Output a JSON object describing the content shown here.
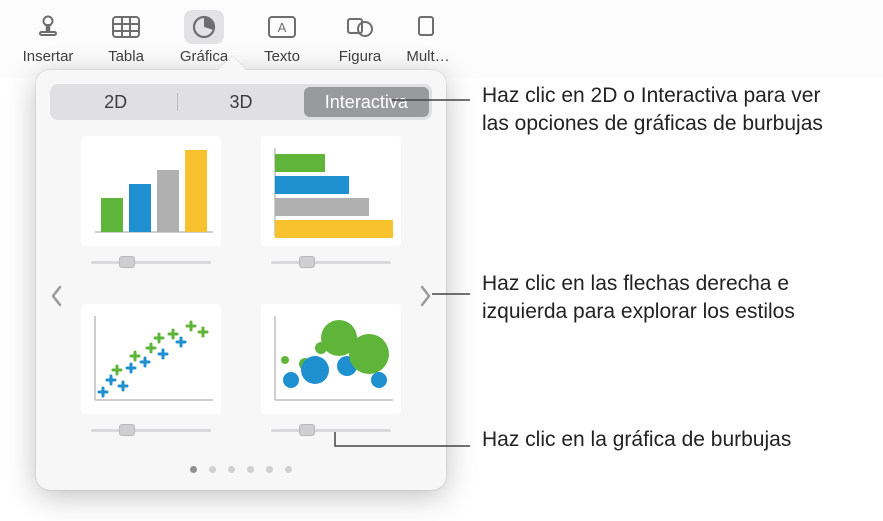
{
  "toolbar": {
    "items": [
      {
        "label": "Insertar",
        "icon": "insert-icon"
      },
      {
        "label": "Tabla",
        "icon": "table-icon"
      },
      {
        "label": "Gráfica",
        "icon": "chart-icon",
        "active": true
      },
      {
        "label": "Texto",
        "icon": "text-icon"
      },
      {
        "label": "Figura",
        "icon": "shape-icon"
      },
      {
        "label": "Mult…",
        "icon": "media-icon"
      }
    ]
  },
  "panel": {
    "tabs": {
      "t0": "2D",
      "t1": "3D",
      "t2": "Interactiva",
      "activeIndex": 2
    },
    "pageCount": 6,
    "activePage": 0
  },
  "charts": {
    "tile0": {
      "type": "bar-vertical"
    },
    "tile1": {
      "type": "bar-horizontal"
    },
    "tile2": {
      "type": "scatter-plus"
    },
    "tile3": {
      "type": "bubble"
    }
  },
  "callouts": {
    "c0": "Haz clic en 2D o Interactiva para ver las opciones de gráficas de burbujas",
    "c1": "Haz clic en las flechas derecha e izquierda para explorar los estilos",
    "c2": "Haz clic en la gráfica de burbujas"
  },
  "colors": {
    "green": "#5fb43a",
    "blue": "#1e8fcf",
    "yellow": "#f7c22e"
  }
}
